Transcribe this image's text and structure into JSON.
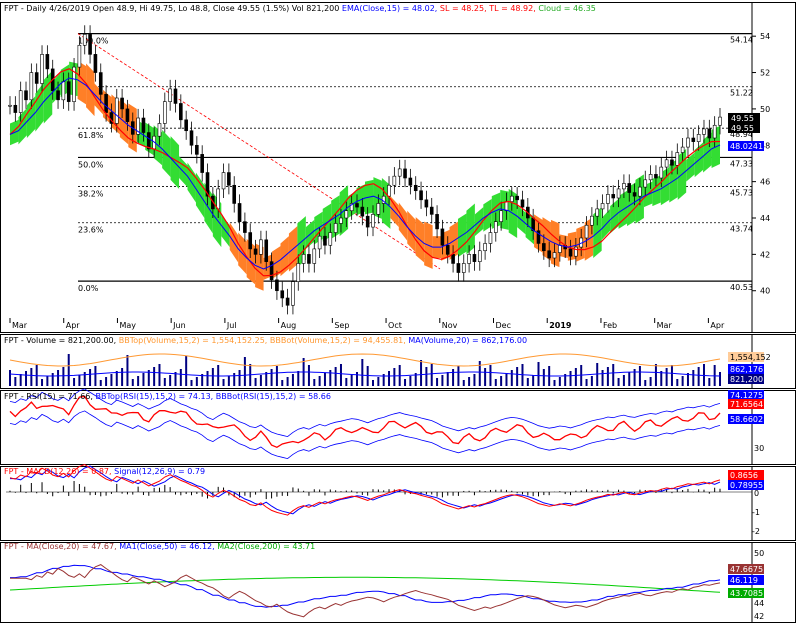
{
  "chart_data": [
    {
      "type": "candlestick",
      "header": {
        "ticker": "FPT - Daily 4/26/2019",
        "ohlc": "Open 48.9, Hi 49.75, Lo 48.8, Close 49.55 (1.5%)",
        "vol": "Vol 821,200",
        "ema": "EMA(Close,15) = 48.02,",
        "sl": "SL = 48.25,",
        "tl": "TL = 48.92,",
        "cloud": "Cloud = 46.35"
      },
      "colors": {
        "ema": "#0000ff",
        "sl": "#ff0000",
        "tl": "#ff0000",
        "cloud_up": "#33dd33",
        "cloud_down": "#ff7f27",
        "trendline": "#ff0000"
      },
      "ylim": [
        38.5,
        55
      ],
      "y_ticks": [
        40,
        42,
        44,
        46,
        48,
        50,
        52,
        54
      ],
      "x_ticks": [
        "Mar",
        "Apr",
        "May",
        "Jun",
        "Jul",
        "Aug",
        "Sep",
        "Oct",
        "Nov",
        "Dec",
        "2019",
        "Feb",
        "Mar",
        "Apr"
      ],
      "fib_levels": [
        {
          "pct": "100.0%",
          "value": 54.14
        },
        {
          "pct": "",
          "value": 51.22
        },
        {
          "pct": "61.8%",
          "value": 48.94
        },
        {
          "pct": "50.0%",
          "value": 47.33
        },
        {
          "pct": "38.2%",
          "value": 45.73
        },
        {
          "pct": "23.6%",
          "value": 43.74
        },
        {
          "pct": "0.0%",
          "value": 40.53
        }
      ],
      "price_tags": {
        "close": "49.55",
        "high": "49.55",
        "ema": "48.0241"
      },
      "close_series": [
        50.2,
        49.8,
        51,
        50.5,
        52,
        51.4,
        53,
        52.2,
        51,
        50.5,
        51.5,
        50.4,
        52.3,
        53.5,
        54.1,
        53,
        52,
        50.8,
        49.8,
        49.2,
        50.6,
        50,
        49.3,
        48.6,
        49.5,
        48.7,
        47.8,
        48.5,
        49.2,
        50.4,
        51.1,
        50.3,
        49.4,
        48.8,
        48,
        47.5,
        46.5,
        45.2,
        44.5,
        45.6,
        46.5,
        45.8,
        44.8,
        43.8,
        43.2,
        42.3,
        42,
        42.8,
        41.6,
        40.6,
        40,
        39.6,
        39.2,
        40.5,
        41.5,
        42,
        41.5,
        42.3,
        43,
        42.5,
        43.2,
        43.7,
        44,
        44.4,
        44.8,
        44.6,
        44.1,
        43.5,
        44.2,
        44.8,
        45.2,
        45.8,
        46.3,
        46.7,
        46.2,
        45.8,
        45.5,
        45,
        44.6,
        44.2,
        43.4,
        42.5,
        42,
        41.5,
        41,
        41.5,
        42,
        41.6,
        42.2,
        42.6,
        43.2,
        43.8,
        44.4,
        44.9,
        45.2,
        45,
        44.6,
        44,
        43.3,
        42.6,
        42.2,
        41.8,
        42.1,
        42.5,
        42.3,
        41.9,
        42.4,
        42.9,
        43.6,
        44.1,
        44.5,
        44.8,
        45.3,
        45.1,
        45.6,
        45.9,
        45.4,
        45.2,
        45.7,
        46.1,
        46.4,
        46.2,
        46.8,
        47.2,
        46.9,
        47.6,
        47.9,
        48.4,
        48.2,
        48.6,
        48.9,
        48.4,
        49.1,
        49.55
      ],
      "ema_series": [
        48.6,
        48.8,
        49.3,
        49.8,
        50.4,
        50.9,
        51.4,
        51.7,
        51.6,
        51.3,
        50.8,
        50.3,
        49.9,
        49.5,
        49.1,
        48.8,
        48.5,
        48.2,
        47.8,
        47.3,
        46.8,
        46.3,
        45.6,
        44.9,
        44.2,
        43.6,
        43,
        42.3,
        41.8,
        41.4,
        41.2,
        41.4,
        41.7,
        42.1,
        42.5,
        42.9,
        43.3,
        43.6,
        43.9,
        44.2,
        44.6,
        44.9,
        45.1,
        45.2,
        45,
        44.6,
        44.1,
        43.5,
        43,
        42.6,
        42.4,
        42.4,
        42.6,
        42.9,
        43.2,
        43.6,
        44,
        44.3,
        44.5,
        44.4,
        44.1,
        43.7,
        43.3,
        43,
        42.7,
        42.5,
        42.4,
        42.5,
        42.7,
        43,
        43.4,
        43.9,
        44.3,
        44.6,
        44.9,
        45.2,
        45.4,
        45.6,
        45.9,
        46.2,
        46.6,
        47,
        47.4,
        47.8,
        48.02
      ]
    },
    {
      "type": "bar",
      "title": "FPT - Volume = 821,200.00,",
      "bbtop_label": "BBTop(Volume,15,2) = 1,554,152.25,",
      "bbbot_label": "BBBot(Volume,15,2) = 94,455.81,",
      "ma_label": "MA(Volume,20) = 862,176.00",
      "tags": [
        "1,554,152",
        "862,176",
        "821,200"
      ]
    },
    {
      "type": "line",
      "title": "FPT - RSI(15) = 71.66,",
      "bbtop_label": "BBTop(RSI(15),15,2) = 74.13,",
      "bbbot_label": "BBBot(RSI(15),15,2) = 58.66",
      "y_ticks": [
        30
      ],
      "tags": [
        "74.1275",
        "71.6564",
        "58.6602"
      ]
    },
    {
      "type": "line",
      "title": "FPT - MACD(12,26) = 0.87,",
      "signal_label": "Signal(12,26,9) = 0.79",
      "y_ticks": [
        0,
        -1,
        -2
      ],
      "tags": [
        "0.8656",
        "0.78955"
      ]
    },
    {
      "type": "line",
      "title": "FPT - MA(Close,20) = 47.67,",
      "ma1_label": "MA1(Close,50) = 46.12,",
      "ma2_label": "MA2(Close,200) = 43.71",
      "y_ticks": [
        50,
        46,
        44,
        42
      ],
      "tags": [
        "47.6675",
        "46.119",
        "43.7085"
      ]
    }
  ]
}
